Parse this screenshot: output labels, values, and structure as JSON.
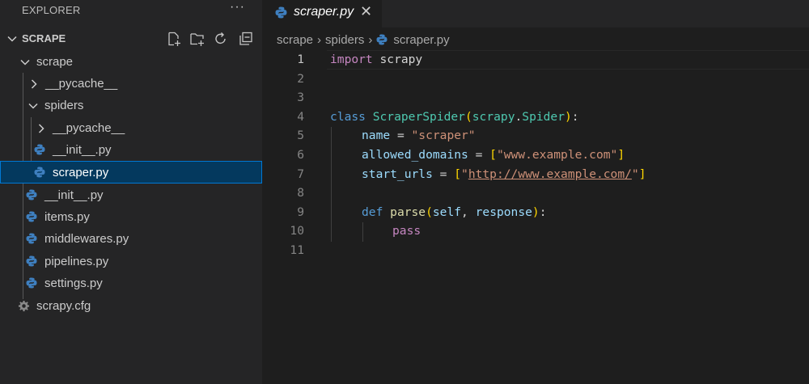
{
  "explorer": {
    "title": "EXPLORER",
    "more": "···",
    "section_title": "SCRAPE"
  },
  "tree": [
    {
      "label": "scrape",
      "kind": "folder",
      "expanded": true
    },
    {
      "label": "__pycache__",
      "kind": "folder",
      "expanded": false
    },
    {
      "label": "spiders",
      "kind": "folder",
      "expanded": true
    },
    {
      "label": "__pycache__",
      "kind": "folder",
      "expanded": false
    },
    {
      "label": "__init__.py",
      "kind": "python"
    },
    {
      "label": "scraper.py",
      "kind": "python",
      "selected": true
    },
    {
      "label": "__init__.py",
      "kind": "python"
    },
    {
      "label": "items.py",
      "kind": "python"
    },
    {
      "label": "middlewares.py",
      "kind": "python"
    },
    {
      "label": "pipelines.py",
      "kind": "python"
    },
    {
      "label": "settings.py",
      "kind": "python"
    },
    {
      "label": "scrapy.cfg",
      "kind": "config"
    }
  ],
  "tab": {
    "label": "scraper.py",
    "close": "✕"
  },
  "breadcrumb": {
    "part1": "scrape",
    "part2": "spiders",
    "part3": "scraper.py",
    "sep": "›"
  },
  "code": {
    "line_numbers": [
      "1",
      "2",
      "3",
      "4",
      "5",
      "6",
      "7",
      "8",
      "9",
      "10",
      "11"
    ],
    "l1_kw": "import",
    "l1_mod": " scrapy",
    "l4_kw": "class",
    "l4_cls": "ScraperSpider",
    "l4_open": "(",
    "l4_mod": "scrapy",
    "l4_dot": ".",
    "l4_base": "Spider",
    "l4_close": ")",
    "l4_colon": ":",
    "l5_var": "name",
    "l5_eq": " = ",
    "l5_str": "\"scraper\"",
    "l6_var": "allowed_domains",
    "l6_eq": " = ",
    "l6_open": "[",
    "l6_str": "\"www.example.com\"",
    "l6_close": "]",
    "l7_var": "start_urls",
    "l7_eq": " = ",
    "l7_open": "[",
    "l7_q1": "\"",
    "l7_url": "http://www.example.com/",
    "l7_q2": "\"",
    "l7_close": "]",
    "l9_kw": "def",
    "l9_fn": "parse",
    "l9_open": "(",
    "l9_p1": "self",
    "l9_comma": ", ",
    "l9_p2": "response",
    "l9_close": ")",
    "l9_colon": ":",
    "l10_kw": "pass"
  },
  "colors": {
    "selected_row": "#04395e",
    "focus_border": "#0078d4",
    "python_icon": "#3e7fbf"
  }
}
